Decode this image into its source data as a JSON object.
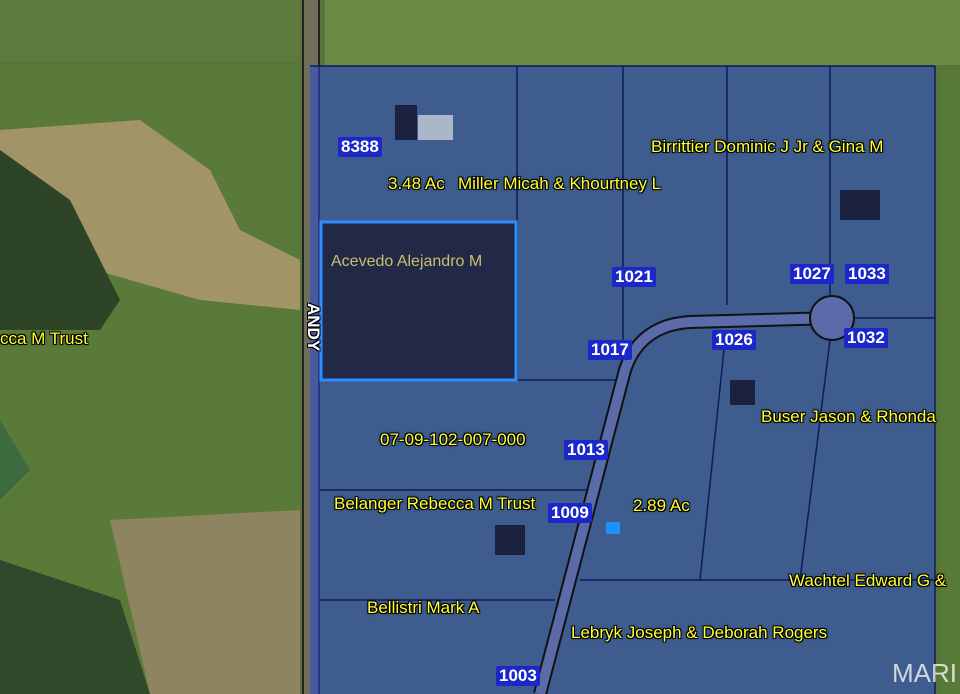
{
  "road_label": "ANDY",
  "watermark": "MARI",
  "selected_parcel": {
    "owner": "Acevedo Alejandro M",
    "outline_color": "#2f8cff"
  },
  "owner_labels": {
    "birrittier": "Birrittier Dominic J Jr & Gina M",
    "miller_acres": "3.48 Ac",
    "miller": "Miller Micah & Khourtney L",
    "becca_trust": "cca M Trust",
    "buser": "Buser Jason & Rhonda",
    "parcel_id": "07-09-102-007-000",
    "belanger": "Belanger Rebecca M Trust",
    "acres_289": "2.89 Ac",
    "wachtel": "Wachtel Edward G &",
    "bellistri": "Bellistri Mark A",
    "lebryk": "Lebryk Joseph & Deborah Rogers"
  },
  "address_numbers": {
    "n8388": "8388",
    "n1021": "1021",
    "n1027": "1027",
    "n1033": "1033",
    "n1017": "1017",
    "n1026": "1026",
    "n1032": "1032",
    "n1013": "1013",
    "n1009": "1009",
    "n1003": "1003"
  },
  "colors": {
    "parcel_overlay": "#2a4bd6",
    "label_text": "#ffff33",
    "address_badge": "#1b27c9",
    "field_green": "#5f7a3e"
  }
}
